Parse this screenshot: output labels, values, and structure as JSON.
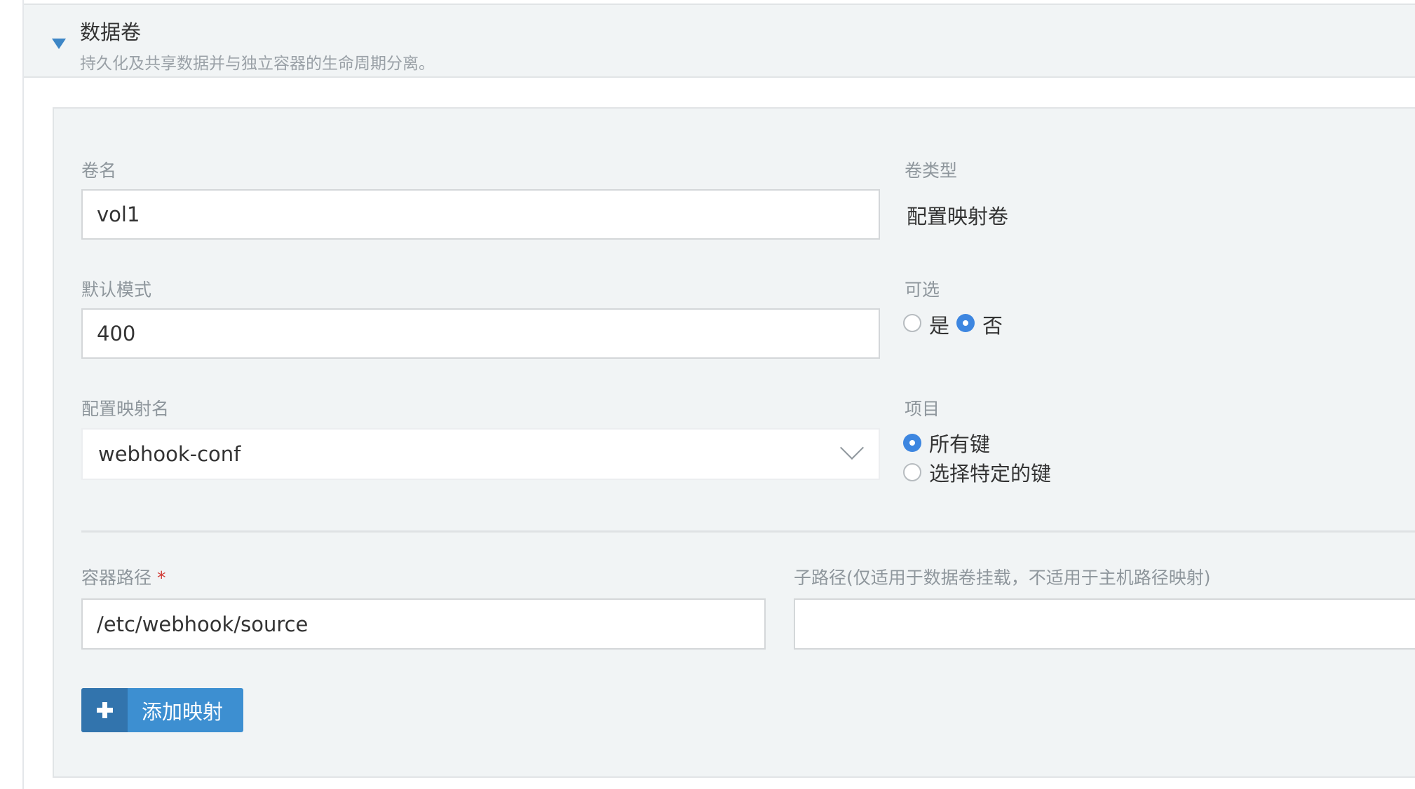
{
  "section": {
    "title": "数据卷",
    "description": "持久化及共享数据并与独立容器的生命周期分离。"
  },
  "volume": {
    "name_label": "卷名",
    "name_value": "vol1",
    "type_label": "卷类型",
    "type_value": "配置映射卷",
    "default_mode_label": "默认模式",
    "default_mode_value": "400",
    "optional_label": "可选",
    "optional_options": [
      {
        "label": "是",
        "checked": false
      },
      {
        "label": "否",
        "checked": true
      }
    ],
    "configmap_label": "配置映射名",
    "configmap_value": "webhook-conf",
    "items_label": "项目",
    "items_options": [
      {
        "label": "所有键",
        "checked": true
      },
      {
        "label": "选择特定的键",
        "checked": false
      }
    ]
  },
  "mount": {
    "container_path_label": "容器路径",
    "required_mark": "*",
    "container_path_value": "/etc/webhook/source",
    "subpath_label": "子路径(仅适用于数据卷挂载，不适用于主机路径映射)",
    "subpath_value": ""
  },
  "actions": {
    "add_mapping_label": "添加映射"
  },
  "colors": {
    "accent": "#3d86e0",
    "button": "#3d8fd1",
    "button_icon_bg": "#3274ad",
    "panel_bg": "#f1f4f5",
    "required": "#d13b36"
  }
}
